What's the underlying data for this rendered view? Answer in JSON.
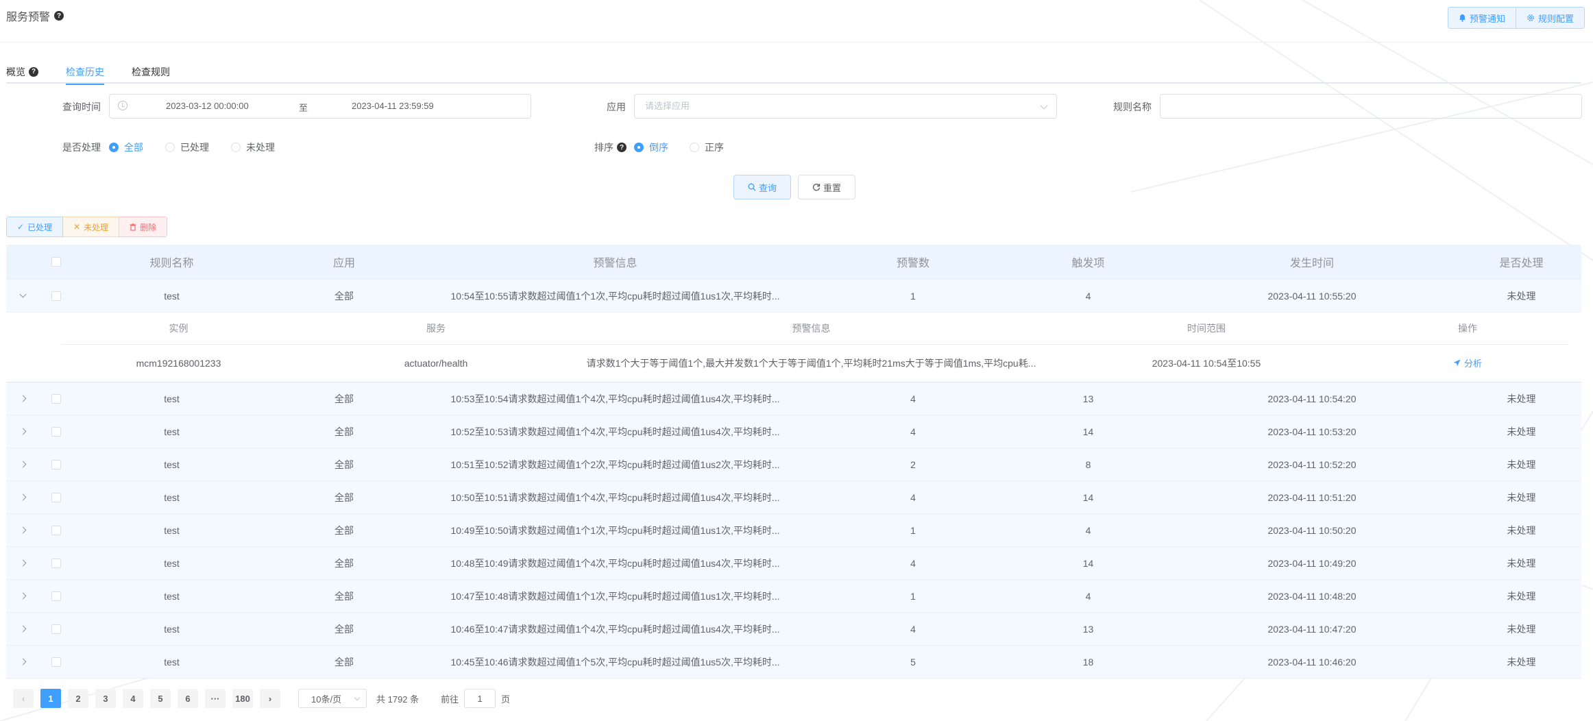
{
  "header": {
    "title": "服务预警",
    "notify_label": "预警通知",
    "config_label": "规则配置"
  },
  "tabs": [
    {
      "label": "概览"
    },
    {
      "label": "检查历史"
    },
    {
      "label": "检查规则"
    }
  ],
  "filters": {
    "query_time_label": "查询时间",
    "start_time": "2023-03-12 00:00:00",
    "range_separator": "至",
    "end_time": "2023-04-11 23:59:59",
    "app_label": "应用",
    "app_placeholder": "请选择应用",
    "rule_name_label": "规则名称",
    "rule_name_value": "",
    "handled_label": "是否处理",
    "handled_options": [
      "全部",
      "已处理",
      "未处理"
    ],
    "handled_selected": "全部",
    "sort_label": "排序",
    "sort_options": [
      "倒序",
      "正序"
    ],
    "sort_selected": "倒序",
    "query_button": "查询",
    "reset_button": "重置"
  },
  "actions": {
    "mark_done": "已处理",
    "mark_undone": "未处理",
    "delete": "删除"
  },
  "table": {
    "columns": [
      "规则名称",
      "应用",
      "预警信息",
      "预警数",
      "触发项",
      "发生时间",
      "是否处理"
    ],
    "rows": [
      {
        "rule": "test",
        "app": "全部",
        "info": "10:54至10:55请求数超过阈值1个1次,平均cpu耗时超过阈值1us1次,平均耗时...",
        "count": "1",
        "triggers": "4",
        "time": "2023-04-11 10:55:20",
        "status": "未处理"
      },
      {
        "rule": "test",
        "app": "全部",
        "info": "10:53至10:54请求数超过阈值1个4次,平均cpu耗时超过阈值1us4次,平均耗时...",
        "count": "4",
        "triggers": "13",
        "time": "2023-04-11 10:54:20",
        "status": "未处理"
      },
      {
        "rule": "test",
        "app": "全部",
        "info": "10:52至10:53请求数超过阈值1个4次,平均cpu耗时超过阈值1us4次,平均耗时...",
        "count": "4",
        "triggers": "14",
        "time": "2023-04-11 10:53:20",
        "status": "未处理"
      },
      {
        "rule": "test",
        "app": "全部",
        "info": "10:51至10:52请求数超过阈值1个2次,平均cpu耗时超过阈值1us2次,平均耗时...",
        "count": "2",
        "triggers": "8",
        "time": "2023-04-11 10:52:20",
        "status": "未处理"
      },
      {
        "rule": "test",
        "app": "全部",
        "info": "10:50至10:51请求数超过阈值1个4次,平均cpu耗时超过阈值1us4次,平均耗时...",
        "count": "4",
        "triggers": "14",
        "time": "2023-04-11 10:51:20",
        "status": "未处理"
      },
      {
        "rule": "test",
        "app": "全部",
        "info": "10:49至10:50请求数超过阈值1个1次,平均cpu耗时超过阈值1us1次,平均耗时...",
        "count": "1",
        "triggers": "4",
        "time": "2023-04-11 10:50:20",
        "status": "未处理"
      },
      {
        "rule": "test",
        "app": "全部",
        "info": "10:48至10:49请求数超过阈值1个4次,平均cpu耗时超过阈值1us4次,平均耗时...",
        "count": "4",
        "triggers": "14",
        "time": "2023-04-11 10:49:20",
        "status": "未处理"
      },
      {
        "rule": "test",
        "app": "全部",
        "info": "10:47至10:48请求数超过阈值1个1次,平均cpu耗时超过阈值1us1次,平均耗时...",
        "count": "1",
        "triggers": "4",
        "time": "2023-04-11 10:48:20",
        "status": "未处理"
      },
      {
        "rule": "test",
        "app": "全部",
        "info": "10:46至10:47请求数超过阈值1个4次,平均cpu耗时超过阈值1us4次,平均耗时...",
        "count": "4",
        "triggers": "13",
        "time": "2023-04-11 10:47:20",
        "status": "未处理"
      },
      {
        "rule": "test",
        "app": "全部",
        "info": "10:45至10:46请求数超过阈值1个5次,平均cpu耗时超过阈值1us5次,平均耗时...",
        "count": "5",
        "triggers": "18",
        "time": "2023-04-11 10:46:20",
        "status": "未处理"
      }
    ],
    "detail": {
      "columns": [
        "实例",
        "服务",
        "预警信息",
        "时间范围",
        "操作"
      ],
      "instance": "mcm192168001233",
      "service": "actuator/health",
      "info": "请求数1个大于等于阈值1个,最大并发数1个大于等于阈值1个,平均耗时21ms大于等于阈值1ms,平均cpu耗...",
      "range": "2023-04-11 10:54至10:55",
      "action": "分析"
    }
  },
  "pagination": {
    "pages": [
      "1",
      "2",
      "3",
      "4",
      "5",
      "6",
      "···",
      "180"
    ],
    "current": "1",
    "page_size": "10条/页",
    "total": "共 1792 条",
    "goto_label": "前往",
    "goto_value": "1",
    "page_unit": "页"
  },
  "icons": {
    "help": "question-circle-icon",
    "bell": "bell-icon",
    "gear": "gear-icon",
    "clock": "clock-icon",
    "search": "search-icon",
    "refresh": "refresh-icon",
    "check": "check-icon",
    "close": "close-icon",
    "trash": "trash-icon",
    "send": "send-icon"
  },
  "colors": {
    "primary": "#409eff",
    "warning": "#e6a23c",
    "danger": "#f56c6c"
  }
}
